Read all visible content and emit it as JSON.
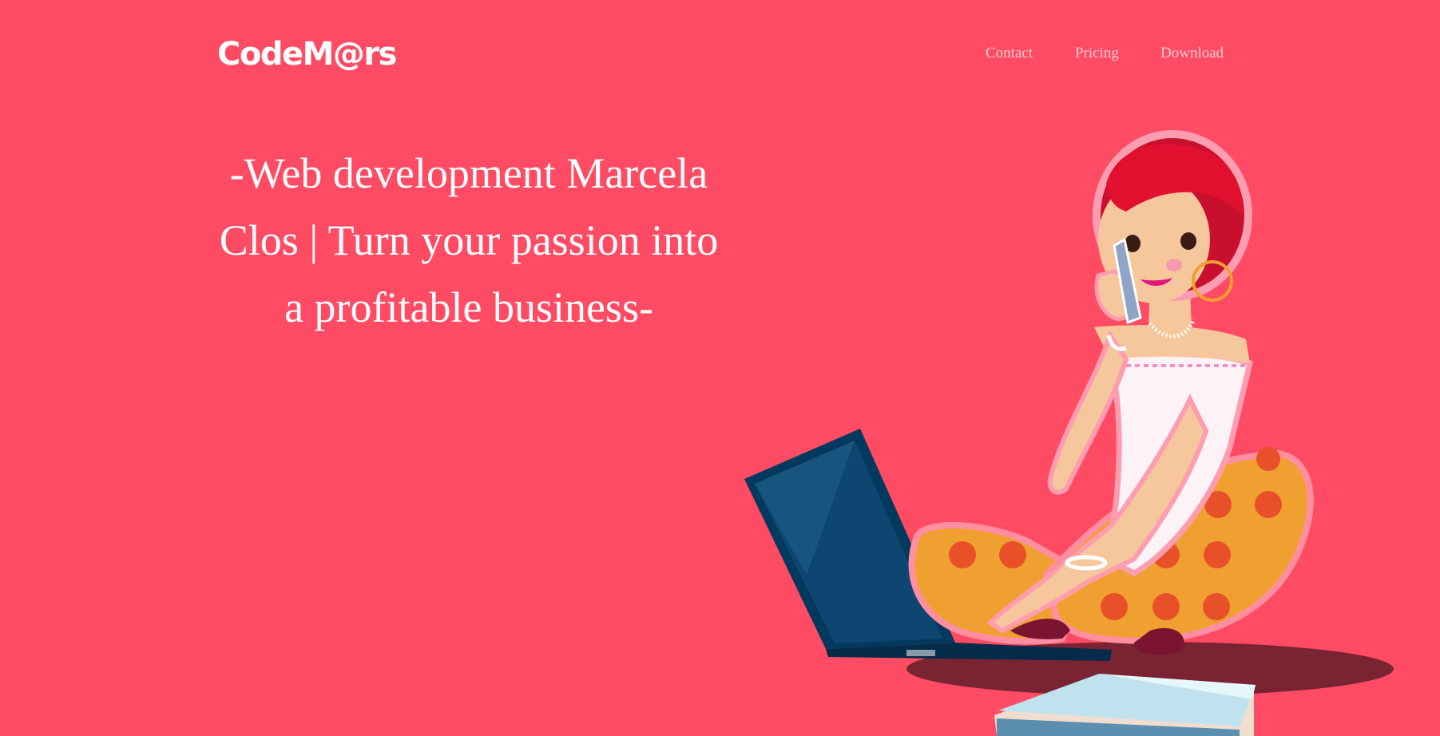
{
  "brand": {
    "logo_text": "CodeM@rs"
  },
  "nav": {
    "items": [
      "Contact",
      "Pricing",
      "Download"
    ]
  },
  "hero": {
    "headline": "-Web development Marcela Clos | Turn your passion into a profitable business-"
  },
  "illustration": {
    "subject": "woman-on-phone-with-laptop"
  },
  "colors": {
    "background": "#ff4b63",
    "text": "#ffffff",
    "nav_text": "#ffd0d6"
  }
}
